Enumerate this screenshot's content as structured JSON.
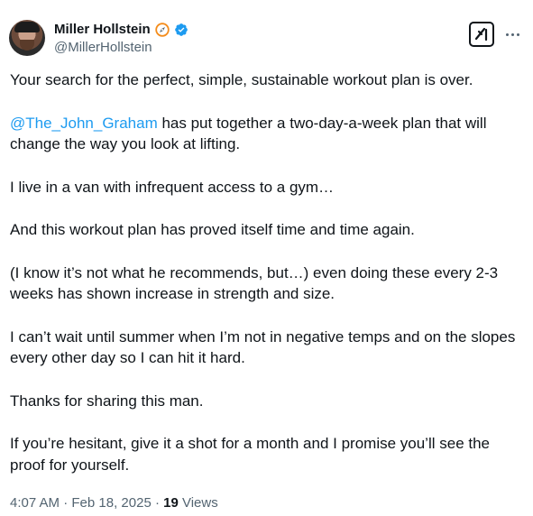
{
  "author": {
    "display_name": "Miller Hollstein",
    "handle": "@MillerHollstein"
  },
  "icons": {
    "avatar": "profile-photo",
    "affiliate_badge": "compass-badge-icon",
    "verified": "verified-badge-icon",
    "grok": "grok-icon",
    "more": "more-dots-icon"
  },
  "colors": {
    "text": "#0f1419",
    "secondary": "#536471",
    "link": "#1d9bf0",
    "verified": "#1d9bf0",
    "badge_orange": "#f48c1b"
  },
  "tweet": {
    "p1": "Your search for the perfect, simple, sustainable workout plan is over.",
    "p2_mention": "@The_John_Graham",
    "p2_rest": " has put together a two-day-a-week plan that will change the way you look at lifting.",
    "p3": "I live in a van with infrequent access to a gym…",
    "p4": "And this workout plan has proved itself time and time again.",
    "p5": "(I know it’s not what he recommends, but…) even doing these every 2-3 weeks has shown increase in strength and size.",
    "p6": "I can’t wait until summer when I’m not in negative temps and on the slopes every other day so I can hit it hard.",
    "p7": "Thanks for sharing this man.",
    "p8": "If you’re hesitant, give it a shot for a month and I promise you’ll see the proof for yourself."
  },
  "meta": {
    "time": "4:07 AM",
    "separator": " · ",
    "date": "Feb 18, 2025",
    "views_count": "19",
    "views_label": " Views"
  }
}
